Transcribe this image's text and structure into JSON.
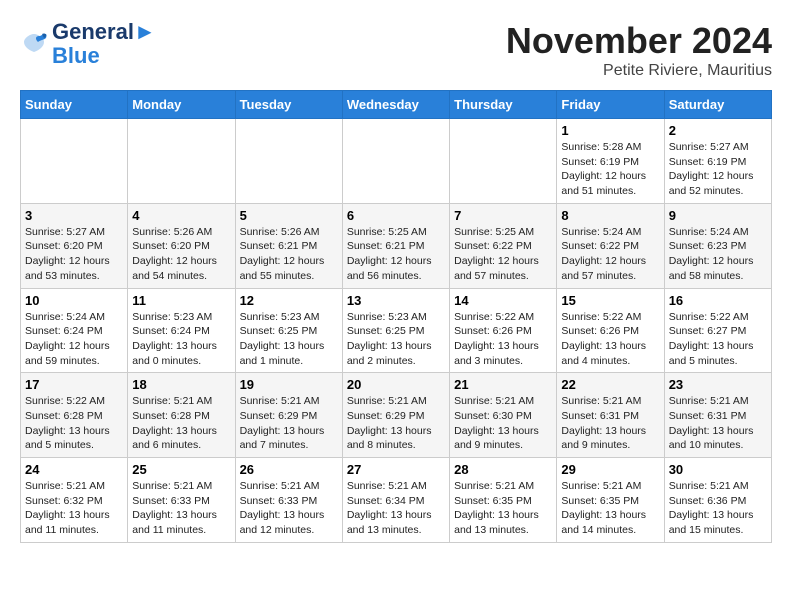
{
  "logo": {
    "line1": "General",
    "line2": "Blue"
  },
  "title": "November 2024",
  "subtitle": "Petite Riviere, Mauritius",
  "weekdays": [
    "Sunday",
    "Monday",
    "Tuesday",
    "Wednesday",
    "Thursday",
    "Friday",
    "Saturday"
  ],
  "weeks": [
    [
      {
        "day": "",
        "info": ""
      },
      {
        "day": "",
        "info": ""
      },
      {
        "day": "",
        "info": ""
      },
      {
        "day": "",
        "info": ""
      },
      {
        "day": "",
        "info": ""
      },
      {
        "day": "1",
        "info": "Sunrise: 5:28 AM\nSunset: 6:19 PM\nDaylight: 12 hours and 51 minutes."
      },
      {
        "day": "2",
        "info": "Sunrise: 5:27 AM\nSunset: 6:19 PM\nDaylight: 12 hours and 52 minutes."
      }
    ],
    [
      {
        "day": "3",
        "info": "Sunrise: 5:27 AM\nSunset: 6:20 PM\nDaylight: 12 hours and 53 minutes."
      },
      {
        "day": "4",
        "info": "Sunrise: 5:26 AM\nSunset: 6:20 PM\nDaylight: 12 hours and 54 minutes."
      },
      {
        "day": "5",
        "info": "Sunrise: 5:26 AM\nSunset: 6:21 PM\nDaylight: 12 hours and 55 minutes."
      },
      {
        "day": "6",
        "info": "Sunrise: 5:25 AM\nSunset: 6:21 PM\nDaylight: 12 hours and 56 minutes."
      },
      {
        "day": "7",
        "info": "Sunrise: 5:25 AM\nSunset: 6:22 PM\nDaylight: 12 hours and 57 minutes."
      },
      {
        "day": "8",
        "info": "Sunrise: 5:24 AM\nSunset: 6:22 PM\nDaylight: 12 hours and 57 minutes."
      },
      {
        "day": "9",
        "info": "Sunrise: 5:24 AM\nSunset: 6:23 PM\nDaylight: 12 hours and 58 minutes."
      }
    ],
    [
      {
        "day": "10",
        "info": "Sunrise: 5:24 AM\nSunset: 6:24 PM\nDaylight: 12 hours and 59 minutes."
      },
      {
        "day": "11",
        "info": "Sunrise: 5:23 AM\nSunset: 6:24 PM\nDaylight: 13 hours and 0 minutes."
      },
      {
        "day": "12",
        "info": "Sunrise: 5:23 AM\nSunset: 6:25 PM\nDaylight: 13 hours and 1 minute."
      },
      {
        "day": "13",
        "info": "Sunrise: 5:23 AM\nSunset: 6:25 PM\nDaylight: 13 hours and 2 minutes."
      },
      {
        "day": "14",
        "info": "Sunrise: 5:22 AM\nSunset: 6:26 PM\nDaylight: 13 hours and 3 minutes."
      },
      {
        "day": "15",
        "info": "Sunrise: 5:22 AM\nSunset: 6:26 PM\nDaylight: 13 hours and 4 minutes."
      },
      {
        "day": "16",
        "info": "Sunrise: 5:22 AM\nSunset: 6:27 PM\nDaylight: 13 hours and 5 minutes."
      }
    ],
    [
      {
        "day": "17",
        "info": "Sunrise: 5:22 AM\nSunset: 6:28 PM\nDaylight: 13 hours and 5 minutes."
      },
      {
        "day": "18",
        "info": "Sunrise: 5:21 AM\nSunset: 6:28 PM\nDaylight: 13 hours and 6 minutes."
      },
      {
        "day": "19",
        "info": "Sunrise: 5:21 AM\nSunset: 6:29 PM\nDaylight: 13 hours and 7 minutes."
      },
      {
        "day": "20",
        "info": "Sunrise: 5:21 AM\nSunset: 6:29 PM\nDaylight: 13 hours and 8 minutes."
      },
      {
        "day": "21",
        "info": "Sunrise: 5:21 AM\nSunset: 6:30 PM\nDaylight: 13 hours and 9 minutes."
      },
      {
        "day": "22",
        "info": "Sunrise: 5:21 AM\nSunset: 6:31 PM\nDaylight: 13 hours and 9 minutes."
      },
      {
        "day": "23",
        "info": "Sunrise: 5:21 AM\nSunset: 6:31 PM\nDaylight: 13 hours and 10 minutes."
      }
    ],
    [
      {
        "day": "24",
        "info": "Sunrise: 5:21 AM\nSunset: 6:32 PM\nDaylight: 13 hours and 11 minutes."
      },
      {
        "day": "25",
        "info": "Sunrise: 5:21 AM\nSunset: 6:33 PM\nDaylight: 13 hours and 11 minutes."
      },
      {
        "day": "26",
        "info": "Sunrise: 5:21 AM\nSunset: 6:33 PM\nDaylight: 13 hours and 12 minutes."
      },
      {
        "day": "27",
        "info": "Sunrise: 5:21 AM\nSunset: 6:34 PM\nDaylight: 13 hours and 13 minutes."
      },
      {
        "day": "28",
        "info": "Sunrise: 5:21 AM\nSunset: 6:35 PM\nDaylight: 13 hours and 13 minutes."
      },
      {
        "day": "29",
        "info": "Sunrise: 5:21 AM\nSunset: 6:35 PM\nDaylight: 13 hours and 14 minutes."
      },
      {
        "day": "30",
        "info": "Sunrise: 5:21 AM\nSunset: 6:36 PM\nDaylight: 13 hours and 15 minutes."
      }
    ]
  ]
}
